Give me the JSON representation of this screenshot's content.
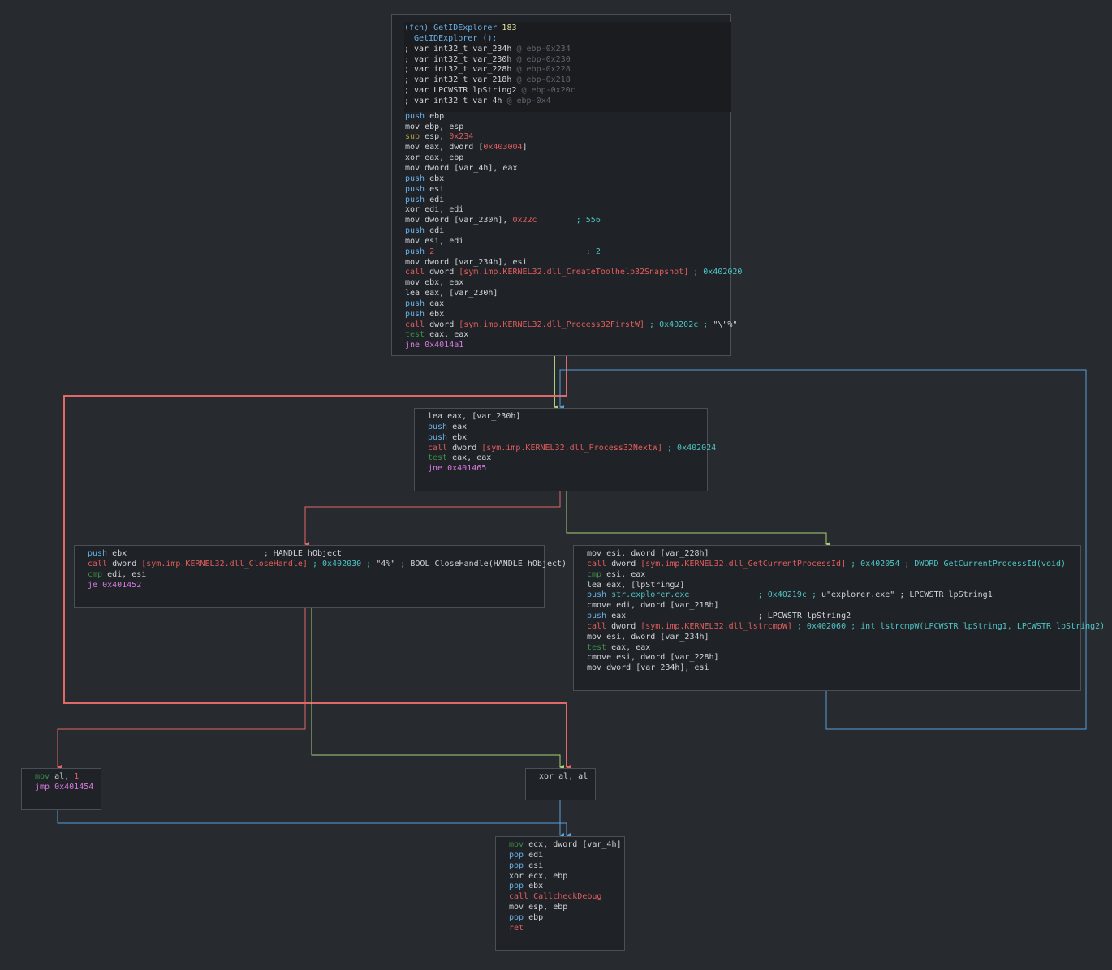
{
  "colors": {
    "background": "#272a2e",
    "block_bg": "#1f2226",
    "edge_true": "#a8d07a",
    "edge_false": "#e06868",
    "edge_uncond": "#5a9fd8"
  },
  "blocks": [
    {
      "id": "b0",
      "lines": [
        [
          [
            "fcn",
            "(fcn) GetIDExplorer "
          ],
          [
            "fnum",
            "183"
          ]
        ],
        [
          [
            "fcn",
            "  GetIDExplorer ();"
          ]
        ],
        [
          [
            "plain",
            "; var int32_t var_234h "
          ],
          [
            "at",
            "@ ebp-0x234"
          ]
        ],
        [
          [
            "plain",
            "; var int32_t var_230h "
          ],
          [
            "at",
            "@ ebp-0x230"
          ]
        ],
        [
          [
            "plain",
            "; var int32_t var_228h "
          ],
          [
            "at",
            "@ ebp-0x228"
          ]
        ],
        [
          [
            "plain",
            "; var int32_t var_218h "
          ],
          [
            "at",
            "@ ebp-0x218"
          ]
        ],
        [
          [
            "plain",
            "; var LPCWSTR lpString2 "
          ],
          [
            "at",
            "@ ebp-0x20c"
          ]
        ],
        [
          [
            "plain",
            "; var int32_t var_4h "
          ],
          [
            "at",
            "@ ebp-0x4"
          ]
        ],
        [
          [
            "mnem",
            "push "
          ],
          [
            "plain",
            "ebp"
          ]
        ],
        [
          [
            "mov",
            "mov "
          ],
          [
            "plain",
            "ebp, esp"
          ]
        ],
        [
          [
            "arith",
            "sub "
          ],
          [
            "plain",
            "esp, "
          ],
          [
            "imm",
            "0x234"
          ]
        ],
        [
          [
            "mov",
            "mov "
          ],
          [
            "plain",
            "eax, dword ["
          ],
          [
            "addr",
            "0x403004"
          ],
          [
            "plain",
            "]"
          ]
        ],
        [
          [
            "xor",
            "xor "
          ],
          [
            "plain",
            "eax, ebp"
          ]
        ],
        [
          [
            "mov",
            "mov "
          ],
          [
            "plain",
            "dword [var_4h], eax"
          ]
        ],
        [
          [
            "mnem",
            "push "
          ],
          [
            "plain",
            "ebx"
          ]
        ],
        [
          [
            "mnem",
            "push "
          ],
          [
            "plain",
            "esi"
          ]
        ],
        [
          [
            "mnem",
            "push "
          ],
          [
            "plain",
            "edi"
          ]
        ],
        [
          [
            "xor",
            "xor "
          ],
          [
            "plain",
            "edi, edi"
          ]
        ],
        [
          [
            "mov",
            "mov "
          ],
          [
            "plain",
            "dword [var_230h], "
          ],
          [
            "imm",
            "0x22c"
          ],
          [
            "cmt",
            "        ; 556"
          ]
        ],
        [
          [
            "mnem",
            "push "
          ],
          [
            "plain",
            "edi"
          ]
        ],
        [
          [
            "mov",
            "mov "
          ],
          [
            "plain",
            "esi, edi"
          ]
        ],
        [
          [
            "mnem",
            "push "
          ],
          [
            "imm",
            "2"
          ],
          [
            "cmt",
            "                               ; 2"
          ]
        ],
        [
          [
            "mov",
            "mov "
          ],
          [
            "plain",
            "dword [var_234h], esi"
          ]
        ],
        [
          [
            "call",
            "call "
          ],
          [
            "plain",
            "dword "
          ],
          [
            "sym",
            "[sym.imp.KERNEL32.dll_CreateToolhelp32Snapshot]"
          ],
          [
            "cmt",
            " ; 0x402020"
          ]
        ],
        [
          [
            "mov",
            "mov "
          ],
          [
            "plain",
            "ebx, eax"
          ]
        ],
        [
          [
            "mov",
            "lea "
          ],
          [
            "plain",
            "eax, [var_230h]"
          ]
        ],
        [
          [
            "mnem",
            "push "
          ],
          [
            "plain",
            "eax"
          ]
        ],
        [
          [
            "mnem",
            "push "
          ],
          [
            "plain",
            "ebx"
          ]
        ],
        [
          [
            "call",
            "call "
          ],
          [
            "plain",
            "dword "
          ],
          [
            "sym",
            "[sym.imp.KERNEL32.dll_Process32FirstW]"
          ],
          [
            "cmt",
            " ; 0x40202c ; "
          ],
          [
            "str",
            "\"\\\"%\""
          ]
        ],
        [
          [
            "test",
            "test "
          ],
          [
            "plain",
            "eax, eax"
          ]
        ],
        [
          [
            "jmp",
            "jne "
          ],
          [
            "jmp",
            "0x4014a1"
          ]
        ]
      ]
    },
    {
      "id": "b1",
      "lines": [
        [
          [
            "mov",
            "lea "
          ],
          [
            "plain",
            "eax, [var_230h]"
          ]
        ],
        [
          [
            "mnem",
            "push "
          ],
          [
            "plain",
            "eax"
          ]
        ],
        [
          [
            "mnem",
            "push "
          ],
          [
            "plain",
            "ebx"
          ]
        ],
        [
          [
            "call",
            "call "
          ],
          [
            "plain",
            "dword "
          ],
          [
            "sym",
            "[sym.imp.KERNEL32.dll_Process32NextW]"
          ],
          [
            "cmt",
            " ; 0x402024"
          ]
        ],
        [
          [
            "test",
            "test "
          ],
          [
            "plain",
            "eax, eax"
          ]
        ],
        [
          [
            "jmp",
            "jne "
          ],
          [
            "jmp",
            "0x401465"
          ]
        ]
      ]
    },
    {
      "id": "b2",
      "lines": [
        [
          [
            "mnem",
            "push "
          ],
          [
            "plain",
            "ebx                            ; HANDLE hObject"
          ]
        ],
        [
          [
            "call",
            "call "
          ],
          [
            "plain",
            "dword "
          ],
          [
            "sym",
            "[sym.imp.KERNEL32.dll_CloseHandle]"
          ],
          [
            "cmt",
            " ; 0x402030 ; "
          ],
          [
            "str",
            "\"4%\" ; BOOL CloseHandle(HANDLE hObject)"
          ]
        ],
        [
          [
            "test",
            "cmp "
          ],
          [
            "plain",
            "edi, esi"
          ]
        ],
        [
          [
            "jmp",
            "je "
          ],
          [
            "jmp",
            "0x401452"
          ]
        ]
      ]
    },
    {
      "id": "b3",
      "lines": [
        [
          [
            "mov",
            "mov "
          ],
          [
            "plain",
            "esi, dword [var_228h]"
          ]
        ],
        [
          [
            "call",
            "call "
          ],
          [
            "plain",
            "dword "
          ],
          [
            "sym",
            "[sym.imp.KERNEL32.dll_GetCurrentProcessId]"
          ],
          [
            "cmt",
            " ; 0x402054 ; DWORD GetCurrentProcessId(void)"
          ]
        ],
        [
          [
            "test",
            "cmp "
          ],
          [
            "plain",
            "esi, eax"
          ]
        ],
        [
          [
            "mov",
            "lea "
          ],
          [
            "plain",
            "eax, [lpString2]"
          ]
        ],
        [
          [
            "mnem",
            "push "
          ],
          [
            "cmt",
            "str.explorer.exe"
          ],
          [
            "cmt",
            "              ; 0x40219c ; "
          ],
          [
            "str",
            "u\"explorer.exe\" ; LPCWSTR lpString1"
          ]
        ],
        [
          [
            "mov",
            "cmove "
          ],
          [
            "plain",
            "edi, dword [var_218h]"
          ]
        ],
        [
          [
            "mnem",
            "push "
          ],
          [
            "plain",
            "eax                           ; LPCWSTR lpString2"
          ]
        ],
        [
          [
            "call",
            "call "
          ],
          [
            "plain",
            "dword "
          ],
          [
            "sym",
            "[sym.imp.KERNEL32.dll_lstrcmpW]"
          ],
          [
            "cmt",
            " ; 0x402060 ; int lstrcmpW(LPCWSTR lpString1, LPCWSTR lpString2)"
          ]
        ],
        [
          [
            "mov",
            "mov "
          ],
          [
            "plain",
            "esi, dword [var_234h]"
          ]
        ],
        [
          [
            "test",
            "test "
          ],
          [
            "plain",
            "eax, eax"
          ]
        ],
        [
          [
            "mov",
            "cmove "
          ],
          [
            "plain",
            "esi, dword [var_228h]"
          ]
        ],
        [
          [
            "mov",
            "mov "
          ],
          [
            "plain",
            "dword [var_234h], esi"
          ]
        ]
      ]
    },
    {
      "id": "b4",
      "lines": [
        [
          [
            "test",
            "mov "
          ],
          [
            "plain",
            "al, "
          ],
          [
            "imm",
            "1"
          ]
        ],
        [
          [
            "jmp",
            "jmp "
          ],
          [
            "jmp",
            "0x401454"
          ]
        ]
      ]
    },
    {
      "id": "b5",
      "lines": [
        [
          [
            "xor",
            "xor "
          ],
          [
            "plain",
            "al, al"
          ]
        ]
      ]
    },
    {
      "id": "b6",
      "lines": [
        [
          [
            "test",
            "mov "
          ],
          [
            "plain",
            "ecx, dword [var_4h]"
          ]
        ],
        [
          [
            "mnem",
            "pop "
          ],
          [
            "plain",
            "edi"
          ]
        ],
        [
          [
            "mnem",
            "pop "
          ],
          [
            "plain",
            "esi"
          ]
        ],
        [
          [
            "xor",
            "xor "
          ],
          [
            "plain",
            "ecx, ebp"
          ]
        ],
        [
          [
            "mnem",
            "pop "
          ],
          [
            "plain",
            "ebx"
          ]
        ],
        [
          [
            "call",
            "call "
          ],
          [
            "call",
            "CallcheckDebug"
          ]
        ],
        [
          [
            "mov",
            "mov "
          ],
          [
            "plain",
            "esp, ebp"
          ]
        ],
        [
          [
            "mnem",
            "pop "
          ],
          [
            "plain",
            "ebp"
          ]
        ],
        [
          [
            "call",
            "ret"
          ]
        ]
      ]
    }
  ]
}
